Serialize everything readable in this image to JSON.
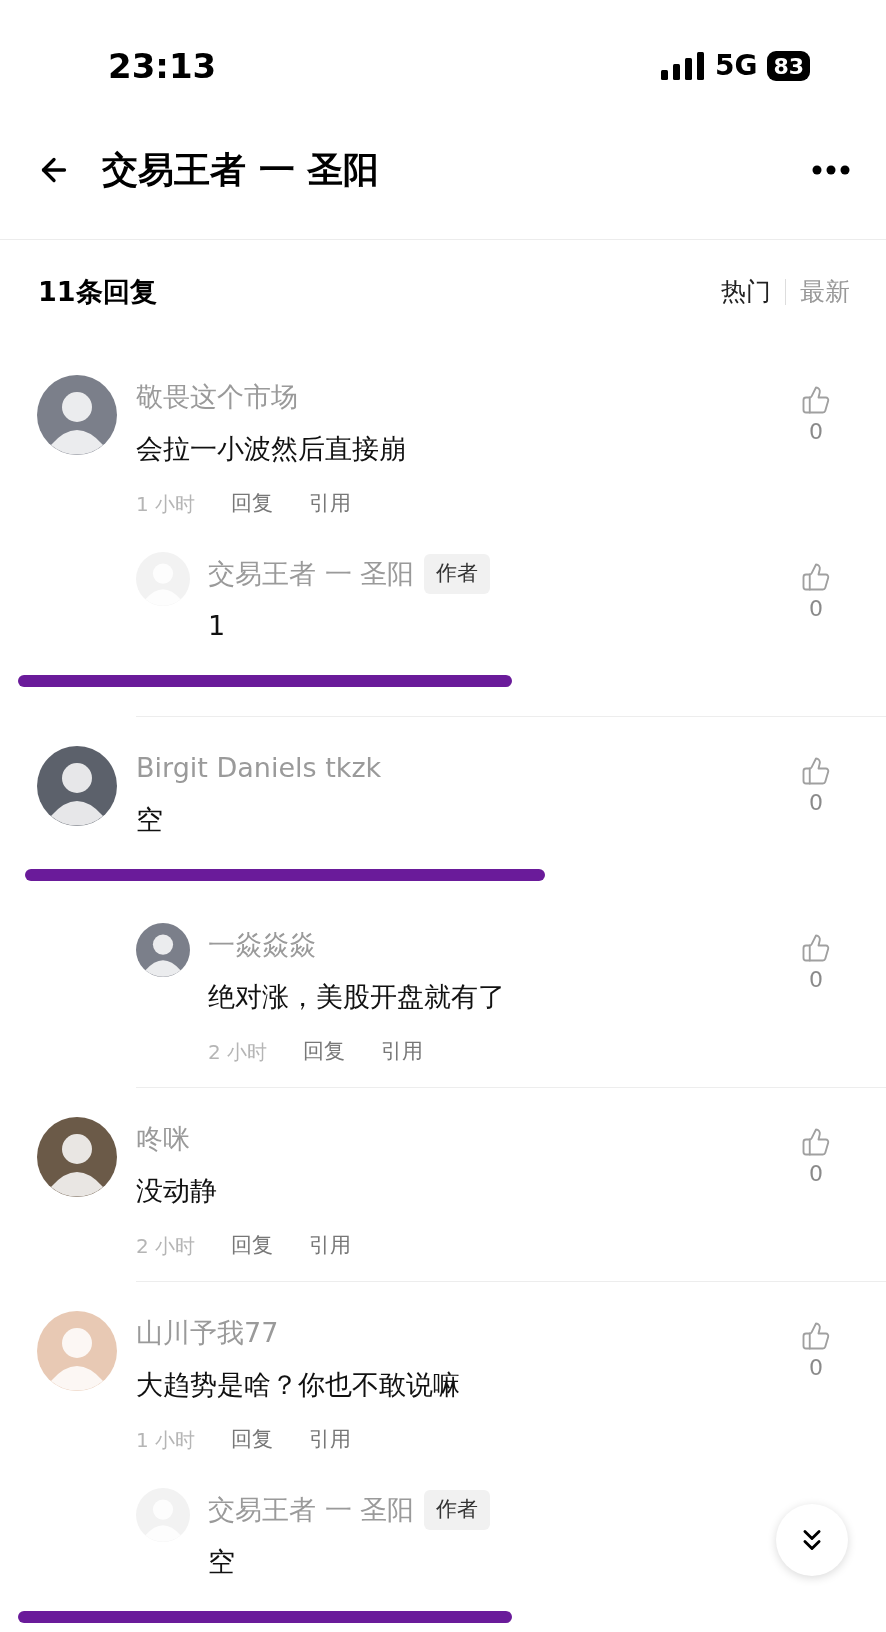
{
  "status_bar": {
    "time": "23:13",
    "network": "5G",
    "battery": "83"
  },
  "header": {
    "title": "交易王者 一 圣阳"
  },
  "replies_header": {
    "count": "11条回复",
    "sort_tabs": [
      {
        "label": "热门",
        "selected": true
      },
      {
        "label": "最新",
        "selected": false
      }
    ]
  },
  "comments": [
    {
      "name": "敬畏这个市场",
      "text": "会拉一小波然后直接崩",
      "time": "1 小时",
      "actions": [
        "回复",
        "引用"
      ],
      "likes": "0",
      "color": "#7b7f8a",
      "struck": false,
      "replies": [
        {
          "name": "交易王者 一 圣阳",
          "badge": "作者",
          "text": "1",
          "likes": "0",
          "color": "#f2f2f2",
          "struck": true
        }
      ]
    },
    {
      "name": "Birgit Daniels tkzk",
      "text": "空",
      "likes": "0",
      "color": "#5c616b",
      "struck": true,
      "replies": [
        {
          "name": "一焱焱焱",
          "text": "绝对涨，美股开盘就有了",
          "time": "2 小时",
          "actions": [
            "回复",
            "引用"
          ],
          "likes": "0",
          "color": "#7b7f8a",
          "struck": false
        }
      ]
    },
    {
      "name": "咚咪",
      "text": "没动静",
      "time": "2 小时",
      "actions": [
        "回复",
        "引用"
      ],
      "likes": "0",
      "color": "#6b5a48",
      "struck": false
    },
    {
      "name": "山川予我77",
      "text": "大趋势是啥？你也不敢说嘛",
      "time": "1 小时",
      "actions": [
        "回复",
        "引用"
      ],
      "likes": "0",
      "color": "#e8c9b4",
      "struck": false,
      "replies": [
        {
          "name": "交易王者 一 圣阳",
          "badge": "作者",
          "text": "空",
          "color": "#f2f2f2",
          "struck": true
        }
      ]
    }
  ]
}
